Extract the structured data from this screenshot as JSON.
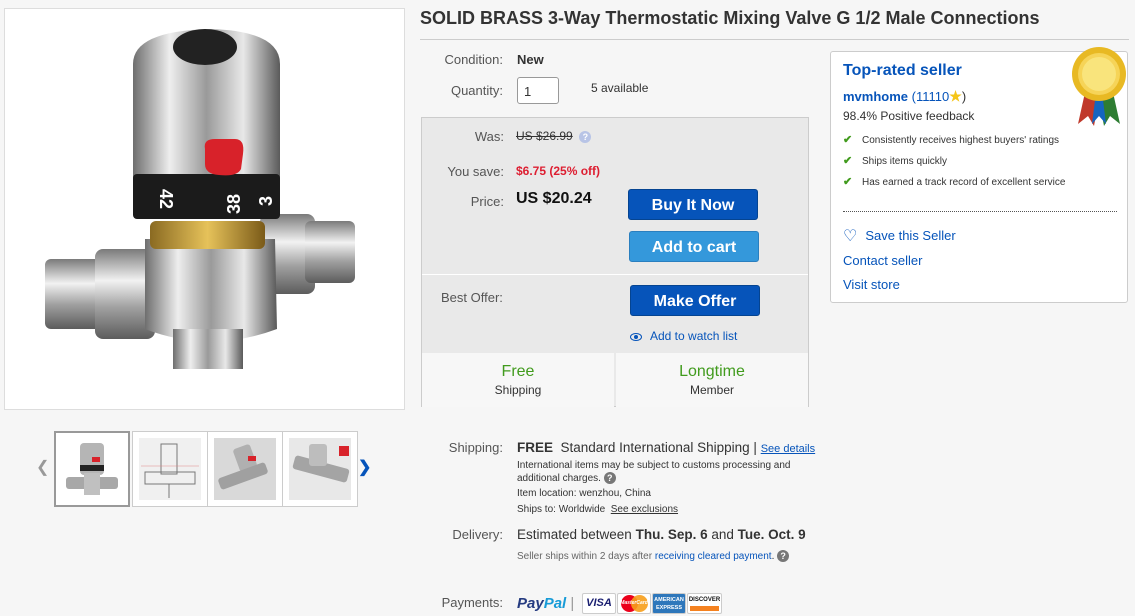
{
  "title": "SOLID BRASS 3-Way Thermostatic Mixing Valve G 1/2 Male Connections",
  "condition": {
    "label": "Condition:",
    "value": "New"
  },
  "quantity": {
    "label": "Quantity:",
    "value": "1",
    "available": "5 available"
  },
  "pricing": {
    "was_label": "Was:",
    "was_value": "US $26.99",
    "save_label": "You save:",
    "save_value": "$6.75 (25% off)",
    "price_label": "Price:",
    "price_value": "US $20.24",
    "buy_now": "Buy It Now",
    "add_to_cart": "Add to cart",
    "best_offer_label": "Best Offer:",
    "make_offer": "Make Offer",
    "watch_list": "Add to watch list",
    "help_glyph": "?"
  },
  "badges": [
    {
      "big": "Free",
      "small": "Shipping"
    },
    {
      "big": "Longtime",
      "small": "Member"
    }
  ],
  "dial_numbers": [
    "42",
    "38",
    "3"
  ],
  "seller": {
    "heading": "Top-rated seller",
    "name": "mvmhome",
    "score": "(11110",
    "score_close": ")",
    "feedback": "98.4% Positive feedback",
    "bullets": [
      "Consistently receives highest buyers' ratings",
      "Ships items quickly",
      "Has earned a track record of excellent service"
    ],
    "save_seller": "Save this Seller",
    "contact": "Contact seller",
    "visit": "Visit store"
  },
  "shipping": {
    "label": "Shipping:",
    "free": "FREE",
    "method": "Standard International Shipping |",
    "see_details": "See details",
    "note": "International items may be subject to customs processing and additional charges.",
    "location_label": "Item location:",
    "location": "wenzhou, China",
    "ships_to_label": "Ships to:",
    "ships_to": "Worldwide",
    "exclusions": "See exclusions"
  },
  "delivery": {
    "label": "Delivery:",
    "prefix": "Estimated between",
    "start": "Thu. Sep. 6",
    "and": "and",
    "end": "Tue. Oct. 9",
    "note_prefix": "Seller ships within 2 days after",
    "note_link": "receiving cleared payment",
    "note_suffix": "."
  },
  "payments": {
    "label": "Payments:",
    "paypal_1": "Pay",
    "paypal_2": "Pal",
    "separator": "|",
    "visa": "VISA",
    "mastercard": "MasterCard",
    "amex_1": "AMERICAN",
    "amex_2": "EXPRESS",
    "discover": "DISCOVER"
  },
  "colors": {
    "accent": "#0654ba",
    "sale": "#dd1e31",
    "green": "#419b1d"
  }
}
